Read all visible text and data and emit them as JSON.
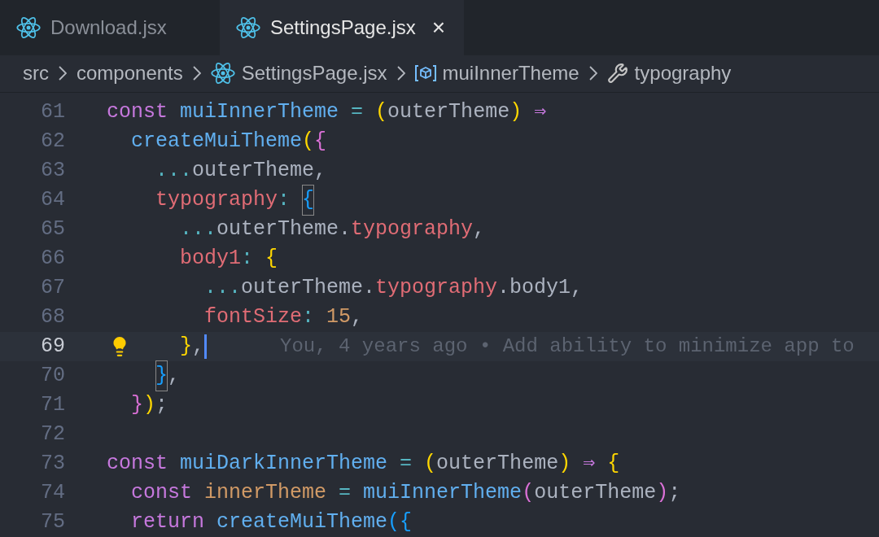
{
  "tabs": [
    {
      "label": "Download.jsx",
      "selected": false
    },
    {
      "label": "SettingsPage.jsx",
      "selected": true,
      "close": "×"
    }
  ],
  "breadcrumb": [
    {
      "label": "src",
      "kind": "folder"
    },
    {
      "label": "components",
      "kind": "folder"
    },
    {
      "label": "SettingsPage.jsx",
      "kind": "react"
    },
    {
      "label": "muiInnerTheme",
      "kind": "symbol"
    },
    {
      "label": "typography",
      "kind": "property"
    }
  ],
  "lines": [
    {
      "number": "61",
      "current": false,
      "tokens": [
        {
          "text": "const ",
          "kind": "keyword"
        },
        {
          "text": "muiInnerTheme",
          "kind": "function"
        },
        {
          "text": " = ",
          "kind": "operator"
        },
        {
          "text": "(",
          "kind": "bracket1"
        },
        {
          "text": "outerTheme",
          "kind": "plain"
        },
        {
          "text": ")",
          "kind": "bracket1"
        },
        {
          "text": " ⇒",
          "kind": "keyword"
        }
      ]
    },
    {
      "number": "62",
      "current": false,
      "tokens": [
        {
          "text": "  createMuiTheme",
          "kind": "function"
        },
        {
          "text": "(",
          "kind": "bracket1"
        },
        {
          "text": "{",
          "kind": "bracket2"
        }
      ]
    },
    {
      "number": "63",
      "current": false,
      "tokens": [
        {
          "text": "    ...",
          "kind": "operator"
        },
        {
          "text": "outerTheme,",
          "kind": "plain"
        }
      ]
    },
    {
      "number": "64",
      "current": false,
      "tokens": [
        {
          "text": "    typography",
          "kind": "property"
        },
        {
          "text": ": ",
          "kind": "operator"
        },
        {
          "text": "{",
          "kind": "bracket3",
          "matched": true
        }
      ]
    },
    {
      "number": "65",
      "current": false,
      "tokens": [
        {
          "text": "      ...",
          "kind": "operator"
        },
        {
          "text": "outerTheme.",
          "kind": "plain"
        },
        {
          "text": "typography",
          "kind": "property"
        },
        {
          "text": ",",
          "kind": "plain"
        }
      ]
    },
    {
      "number": "66",
      "current": false,
      "tokens": [
        {
          "text": "      body1",
          "kind": "property"
        },
        {
          "text": ": ",
          "kind": "operator"
        },
        {
          "text": "{",
          "kind": "bracket1"
        }
      ]
    },
    {
      "number": "67",
      "current": false,
      "tokens": [
        {
          "text": "        ...",
          "kind": "operator"
        },
        {
          "text": "outerTheme.",
          "kind": "plain"
        },
        {
          "text": "typography",
          "kind": "property"
        },
        {
          "text": ".body1,",
          "kind": "plain"
        }
      ]
    },
    {
      "number": "68",
      "current": false,
      "tokens": [
        {
          "text": "        fontSize",
          "kind": "property"
        },
        {
          "text": ": ",
          "kind": "operator"
        },
        {
          "text": "15",
          "kind": "number"
        },
        {
          "text": ",",
          "kind": "plain"
        }
      ]
    },
    {
      "number": "69",
      "current": true,
      "blame": "You, 4 years ago • Add ability to minimize app to",
      "tokens": [
        {
          "text": "      }",
          "kind": "bracket1"
        },
        {
          "text": ",",
          "kind": "plain"
        }
      ]
    },
    {
      "number": "70",
      "current": false,
      "tokens": [
        {
          "text": "    }",
          "kind": "bracket3",
          "matched": true
        },
        {
          "text": ",",
          "kind": "plain"
        }
      ]
    },
    {
      "number": "71",
      "current": false,
      "tokens": [
        {
          "text": "  }",
          "kind": "bracket2"
        },
        {
          "text": ")",
          "kind": "bracket1"
        },
        {
          "text": ";",
          "kind": "plain"
        }
      ]
    },
    {
      "number": "72",
      "current": false
    },
    {
      "number": "73",
      "current": false,
      "tokens": [
        {
          "text": "const ",
          "kind": "keyword"
        },
        {
          "text": "muiDarkInnerTheme",
          "kind": "function"
        },
        {
          "text": " = ",
          "kind": "operator"
        },
        {
          "text": "(",
          "kind": "bracket1"
        },
        {
          "text": "outerTheme",
          "kind": "plain"
        },
        {
          "text": ")",
          "kind": "bracket1"
        },
        {
          "text": " ⇒ ",
          "kind": "keyword"
        },
        {
          "text": "{",
          "kind": "bracket1"
        }
      ]
    },
    {
      "number": "74",
      "current": false,
      "tokens": [
        {
          "text": "  const ",
          "kind": "keyword"
        },
        {
          "text": "innerTheme",
          "kind": "variable"
        },
        {
          "text": " = ",
          "kind": "operator"
        },
        {
          "text": "muiInnerTheme",
          "kind": "function"
        },
        {
          "text": "(",
          "kind": "bracket2"
        },
        {
          "text": "outerTheme",
          "kind": "plain"
        },
        {
          "text": ")",
          "kind": "bracket2"
        },
        {
          "text": ";",
          "kind": "plain"
        }
      ]
    },
    {
      "number": "75",
      "current": false,
      "tokens": [
        {
          "text": "  return ",
          "kind": "keyword"
        },
        {
          "text": "createMuiTheme",
          "kind": "function"
        },
        {
          "text": "(",
          "kind": "bracket3"
        },
        {
          "text": "{",
          "kind": "bracket3"
        }
      ]
    }
  ]
}
